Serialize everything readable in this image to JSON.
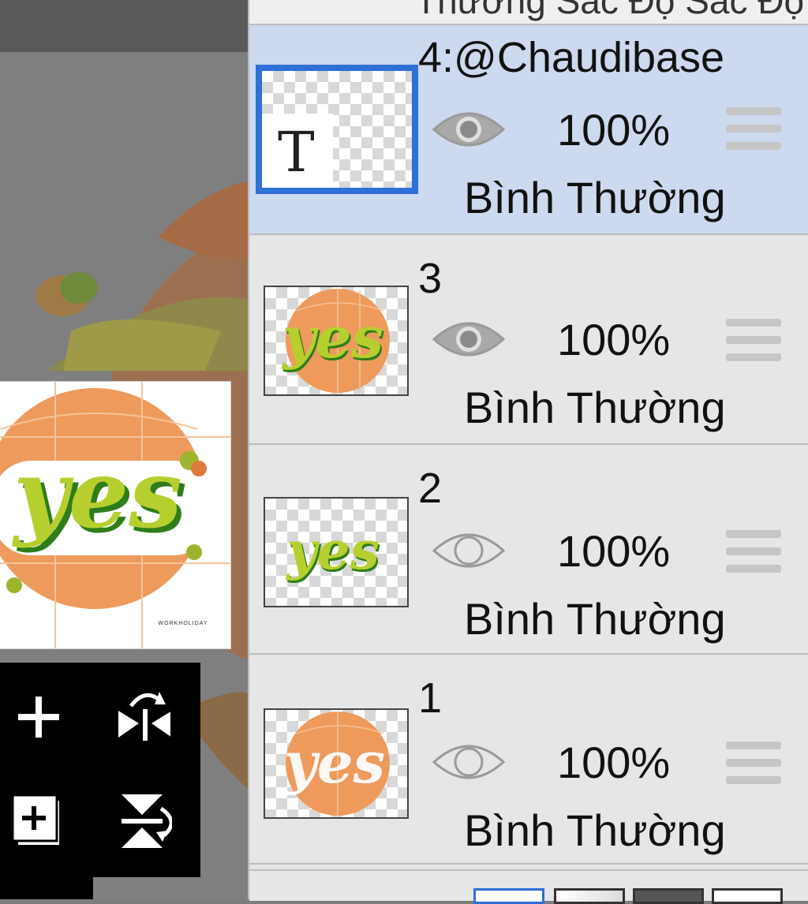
{
  "panel_top_cut_text": "Thường Sắc Độ Sắc Độ",
  "layers": [
    {
      "name": "4:@Chaudibase",
      "opacity": "100%",
      "blend_mode": "Bình Thường",
      "visible": true,
      "selected": true,
      "thumb_type": "text",
      "thumb_glyph": "T"
    },
    {
      "name": "3",
      "opacity": "100%",
      "blend_mode": "Bình Thường",
      "visible": true,
      "selected": false,
      "thumb_type": "yes-full"
    },
    {
      "name": "2",
      "opacity": "100%",
      "blend_mode": "Bình Thường",
      "visible": false,
      "selected": false,
      "thumb_type": "yes-green"
    },
    {
      "name": "1",
      "opacity": "100%",
      "blend_mode": "Bình Thường",
      "visible": false,
      "selected": false,
      "thumb_type": "yes-orange"
    }
  ],
  "preview": {
    "text": "yes",
    "small_print": "WORKHOLIDAY"
  },
  "tools": [
    {
      "name": "add-layer",
      "icon": "plus-icon"
    },
    {
      "name": "flip-horizontal",
      "icon": "flip-horizontal-icon"
    },
    {
      "name": "duplicate-layer",
      "icon": "add-copy-icon"
    },
    {
      "name": "flip-vertical",
      "icon": "flip-vertical-icon"
    }
  ],
  "colors": {
    "selection_blue": "#2f6fd6",
    "selected_row": "#ccd9ef",
    "panel_bg": "#e6e6e6",
    "orange": "#ee9a5c",
    "lime": "#b7cf2e",
    "green_dark": "#2e7d1a"
  }
}
